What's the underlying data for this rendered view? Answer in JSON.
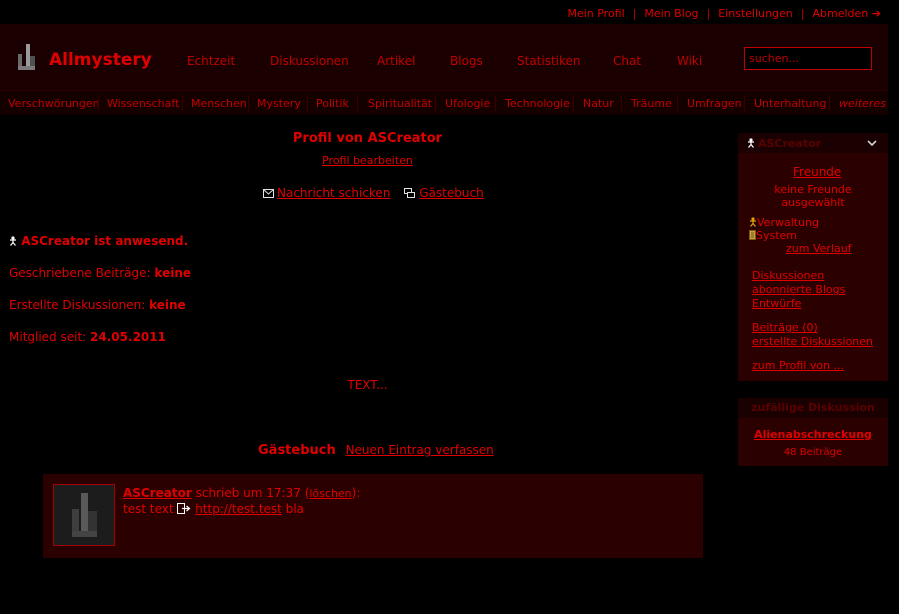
{
  "userbar": {
    "my_profile": "Mein Profil",
    "my_blog": "Mein Blog",
    "settings": "Einstellungen",
    "logout": "Abmelden",
    "logout_arrow": "➔"
  },
  "header": {
    "logo": "Allmystery",
    "nav": [
      "Echtzeit",
      "Diskussionen",
      "Artikel",
      "Blogs",
      "Statistiken",
      "Chat",
      "Wiki"
    ],
    "search_placeholder": "suchen..."
  },
  "categories": [
    "Verschwörungen",
    "Wissenschaft",
    "Menschen",
    "Mystery",
    "Politik",
    "Spiritualität",
    "Ufologie",
    "Technologie",
    "Natur",
    "Träume",
    "Umfragen",
    "Unterhaltung",
    "weiteres"
  ],
  "profile": {
    "title": "Profil von ASCreator",
    "edit": "Profil bearbeiten",
    "send_message": "Nachricht schicken",
    "guestbook_link": "Gästebuch",
    "online": "ASCreator ist anwesend.",
    "posts_label": "Geschriebene Beiträge:",
    "posts_value": "keine",
    "discs_label": "Erstellte Diskussionen:",
    "discs_value": "keine",
    "since_label": "Mitglied seit:",
    "since_value": "24.05.2011",
    "text": "TEXT..."
  },
  "guestbook": {
    "heading": "Gästebuch",
    "new_entry": "Neuen Eintrag verfassen",
    "entry": {
      "author": "ASCreator",
      "wrote_at": "schrieb um 17:37",
      "open_paren": "(",
      "delete": "löschen",
      "close_paren": "):",
      "text_before": "test text",
      "link": "http://test.test",
      "text_after": "bla"
    }
  },
  "sidebar": {
    "username": "ASCreator",
    "friends": "Freunde",
    "no_friends": "keine Freunde ausgewählt",
    "admin": "Verwaltung",
    "system": "System",
    "history": "zum Verlauf",
    "links1": [
      "Diskussionen",
      "abonnierte Blogs",
      "Entwürfe"
    ],
    "links2": [
      "Beiträge (0)",
      "erstellte Diskussionen"
    ],
    "profile_of": "zum Profil von ..."
  },
  "random_discussion": {
    "heading": "zufällige Diskussion",
    "title": "Alienabschreckung",
    "count": "48 Beiträge"
  },
  "colors": {
    "accent": "#e00000",
    "bg": "#000000",
    "panel": "#2a0000",
    "header": "#1a0000"
  }
}
